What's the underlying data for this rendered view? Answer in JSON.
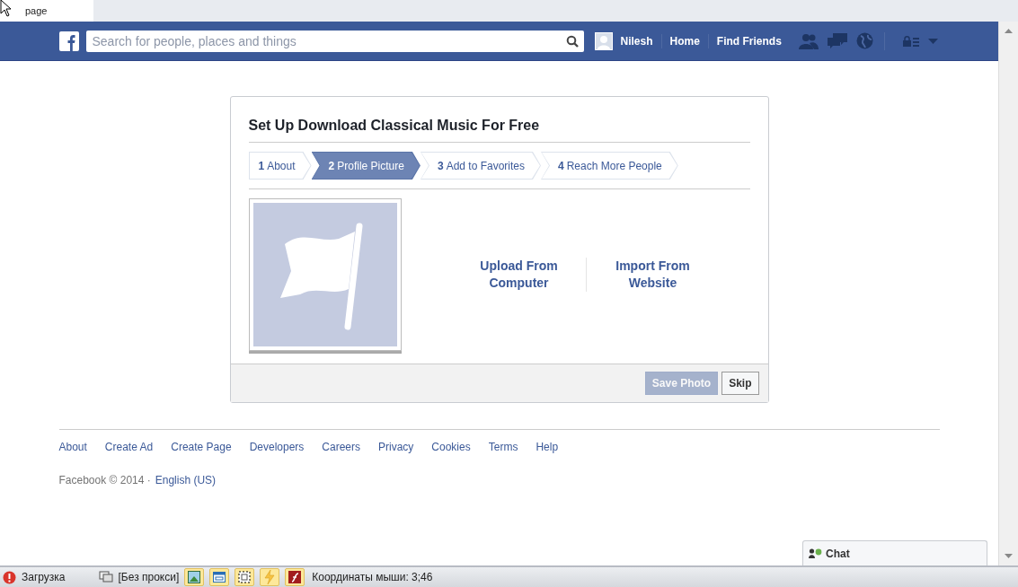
{
  "browser_tab": {
    "title": "page"
  },
  "navbar": {
    "search": {
      "placeholder": "Search for people, places and things"
    },
    "profile_name": "Nilesh",
    "links": [
      "Home",
      "Find Friends"
    ]
  },
  "setup": {
    "title": "Set Up Download Classical Music For Free",
    "steps": [
      {
        "number": "1",
        "label": "About",
        "selected": false
      },
      {
        "number": "2",
        "label": "Profile Picture",
        "selected": true
      },
      {
        "number": "3",
        "label": "Add to Favorites",
        "selected": false
      },
      {
        "number": "4",
        "label": "Reach More People",
        "selected": false
      }
    ],
    "options": [
      "Upload From Computer",
      "Import From Website"
    ],
    "buttons": [
      {
        "label": "Save Photo",
        "disabled": true
      },
      {
        "label": "Skip",
        "disabled": false
      }
    ]
  },
  "footer": {
    "links": [
      "About",
      "Create Ad",
      "Create Page",
      "Developers",
      "Careers",
      "Privacy",
      "Cookies",
      "Terms",
      "Help"
    ],
    "copyright": "Facebook © 2014 ·",
    "language": "English (US)"
  },
  "chat": {
    "label": "Chat"
  },
  "status_bar": {
    "loading": "Загрузка",
    "proxy": "[Без прокси]",
    "coordinates": "Координаты мыши: 3;46"
  }
}
